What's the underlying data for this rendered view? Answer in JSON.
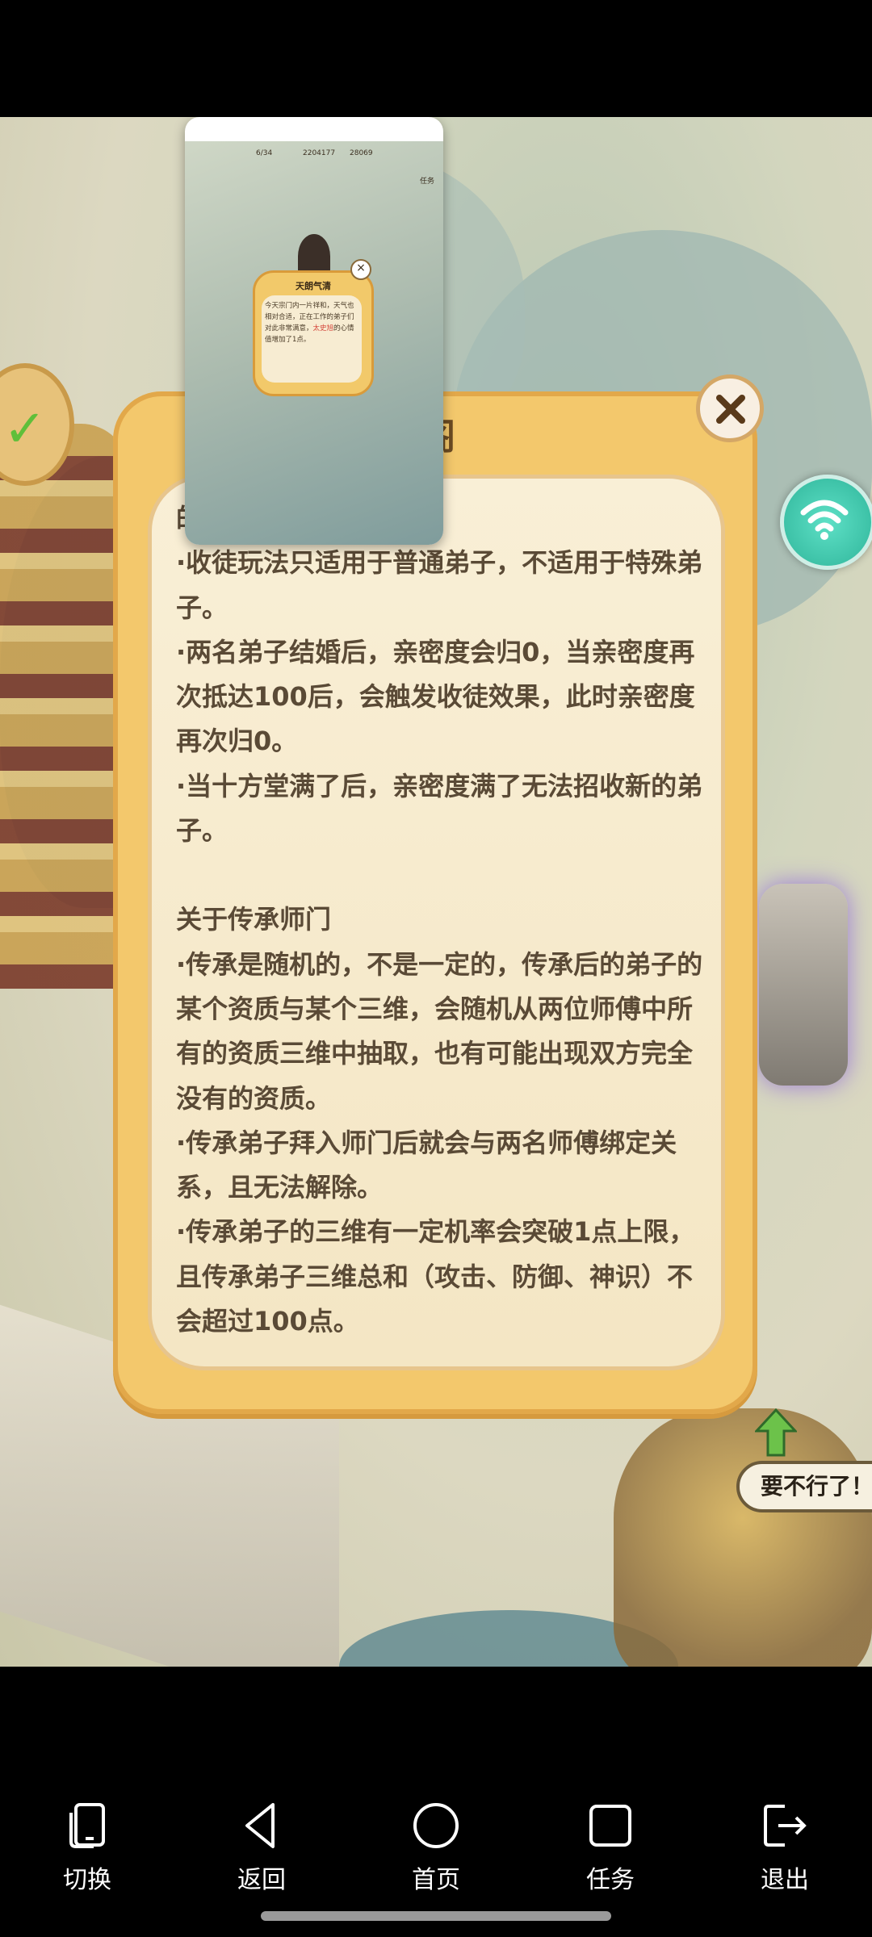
{
  "dialog": {
    "title": "阁",
    "paragraphs": [
      "·收徒玩法只适用于普通弟子，不适用于特殊弟子。",
      "·两名弟子结婚后，亲密度会归0，当亲密度再次抵达100后，会触发收徒效果，此时亲密度再次归0。",
      "·当十方堂满了后，亲密度满了无法招收新的弟子。",
      "",
      "关于传承师门",
      "·传承是随机的，不是一定的，传承后的弟子的某个资质与某个三维，会随机从两位师傅中所有的资质三维中抽取，也有可能出现双方完全没有的资质。",
      "·传承弟子拜入师门后就会与两名师傅绑定关系，且无法解除。",
      "·传承弟子的三维有一定机率会突破1点上限，且传承弟子三维总和（攻击、防御、神识）不会超过100点。"
    ],
    "first_line_clip": "的"
  },
  "thumbnail": {
    "topbar": {
      "level": "6/34",
      "coins": "2204177",
      "gems": "28069",
      "tag": "任务"
    },
    "popup_title": "天朗气清",
    "popup_text_a": "今天宗门内一片祥和，天气也相对合适，正在工作的弟子们对此非常满意，",
    "popup_text_hl": "太史旭",
    "popup_text_b": "的心情值增加了1点。"
  },
  "scene": {
    "speech_bubble": "要不行了！"
  },
  "navbar": {
    "items": [
      {
        "label": "切换",
        "icon": "switch-icon"
      },
      {
        "label": "返回",
        "icon": "back-icon"
      },
      {
        "label": "首页",
        "icon": "home-icon"
      },
      {
        "label": "任务",
        "icon": "tasks-icon"
      },
      {
        "label": "退出",
        "icon": "exit-icon"
      }
    ]
  },
  "colors": {
    "dialog_frame": "#f3c86c",
    "dialog_paper": "#f9efd6",
    "text": "#5a4a36",
    "wifi": "#2fb59a"
  }
}
